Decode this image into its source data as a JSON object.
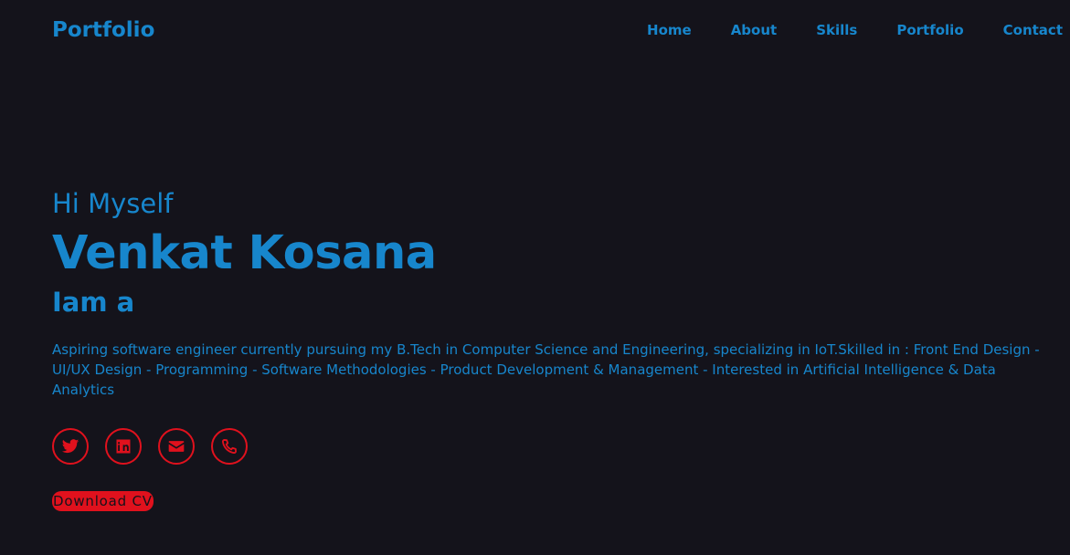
{
  "header": {
    "logo": "Portfolio",
    "nav": [
      {
        "label": "Home"
      },
      {
        "label": "About"
      },
      {
        "label": "Skills"
      },
      {
        "label": "Portfolio"
      },
      {
        "label": "Contact"
      }
    ]
  },
  "hero": {
    "greeting": "Hi Myself",
    "name": "Venkat Kosana",
    "role_prefix": "Iam a",
    "bio": "Aspiring software engineer currently pursuing my B.Tech in Computer Science and Engineering, specializing in IoT.Skilled in : Front End Design - UI/UX Design - Programming - Software Methodologies - Product Development & Management - Interested in Artificial Intelligence & Data Analytics",
    "socials": [
      {
        "icon": "twitter-icon"
      },
      {
        "icon": "linkedin-icon"
      },
      {
        "icon": "envelope-icon"
      },
      {
        "icon": "phone-icon"
      }
    ],
    "cv_label": "Download CV"
  },
  "colors": {
    "background": "#14131b",
    "accent": "#1786cc",
    "social": "#e0111d"
  }
}
